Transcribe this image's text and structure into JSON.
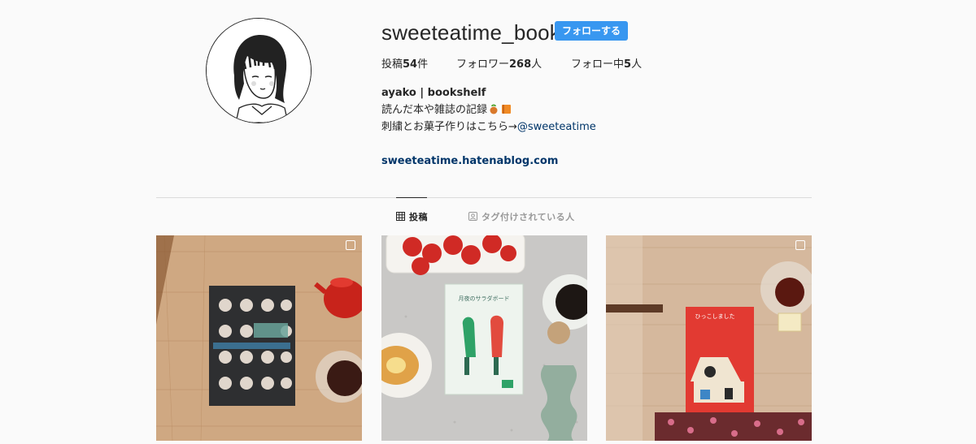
{
  "profile": {
    "username": "sweeteatime_book",
    "follow_label": "フォローする",
    "stats": {
      "posts_prefix": "投稿",
      "posts_count": "54",
      "posts_suffix": "件",
      "followers_prefix": "フォロワー",
      "followers_count": "268",
      "followers_suffix": "人",
      "following_prefix": "フォロー中",
      "following_count": "5",
      "following_suffix": "人"
    },
    "bio": {
      "name": "ayako | bookshelf",
      "line1": "読んだ本や雑誌の記録",
      "line2_text": "刺繍とお菓子作りはこちら→",
      "line2_mention": "@sweeteatime",
      "website": "sweeteatime.hatenablog.com"
    }
  },
  "tabs": {
    "posts": "投稿",
    "tagged": "タグ付けされている人"
  },
  "posts": [
    {
      "icon": "multiple-images-icon"
    },
    {
      "icon": ""
    },
    {
      "icon": "multiple-images-icon"
    }
  ],
  "post_text": {
    "book2_title": "月夜のサラダボード",
    "book3_title": "ひっこしました"
  },
  "colors": {
    "accent": "#3897f0",
    "link": "#003569",
    "divider": "#dbdbdb"
  }
}
